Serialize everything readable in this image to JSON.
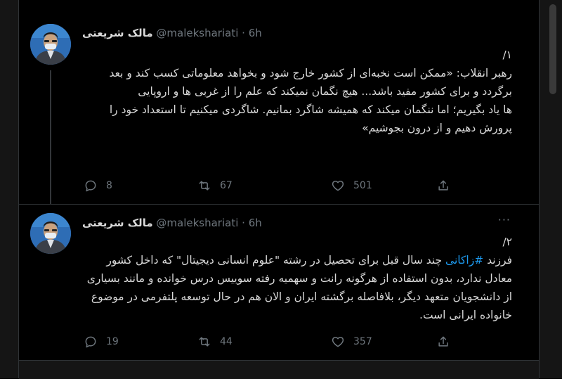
{
  "tweets": [
    {
      "display_name": "مالک شریعتی",
      "handle": "@malekshariati",
      "separator": "·",
      "time": "6h",
      "lines": [
        "۱/",
        "رهبر انقلاب: «ممکن است نخبه‌ای از کشور خارج شود و بخواهد معلوماتی کسب کند و بعد برگردد و برای کشور مفید باشد... هیچ نگمان نمیکند که علم را از غربی ها و اروپایی",
        "ها یاد بگیریم؛ اما ننگمان میکند که همیشه شاگرد بمانیم. شاگردی میکنیم تا استعداد خود را",
        "پرورش دهیم و از درون بجوشیم»"
      ],
      "replies": "8",
      "retweets": "67",
      "likes": "501"
    },
    {
      "display_name": "مالک شریعتی",
      "handle": "@malekshariati",
      "separator": "·",
      "time": "6h",
      "more": "···",
      "line1": "۲/",
      "line2_before": "فرزند ",
      "hashtag": "#زاکانی",
      "line2_after": " چند سال قبل برای تحصیل در رشته \"علوم انسانی دیجیتال\" که داخل کشور معادل ندارد، بدون استفاده از هرگونه رانت و سهمیه رفته سوییس درس خوانده و مانند بسیاری از دانشجویان متعهد دیگر، بلافاصله برگشته ایران و الان هم در حال توسعه پلتفرمی در موضوع خانواده ایرانی است.",
      "replies": "19",
      "retweets": "44",
      "likes": "357"
    }
  ],
  "icons": {
    "reply": "reply-icon",
    "retweet": "retweet-icon",
    "like": "heart-icon",
    "share": "share-icon"
  },
  "colors": {
    "background": "#000000",
    "text": "#d9d9d9",
    "muted": "#6e767d",
    "hashtag": "#1d9bf0"
  }
}
